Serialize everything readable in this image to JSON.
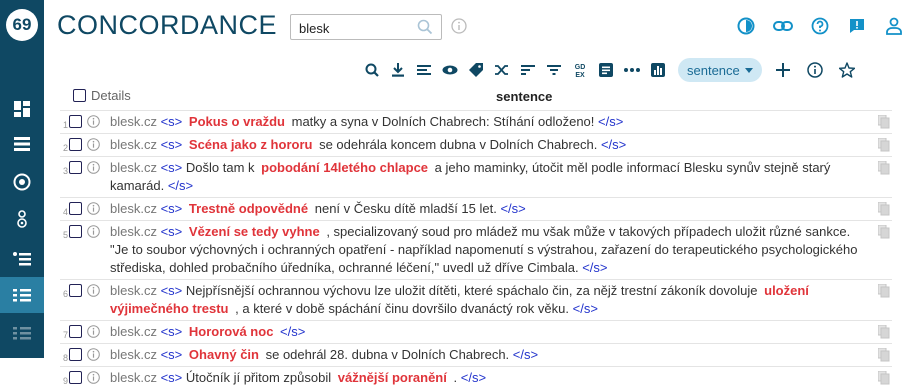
{
  "app": {
    "title": "CONCORDANCE"
  },
  "search": {
    "value": "blesk"
  },
  "toolbar": {
    "view_mode": "sentence"
  },
  "table": {
    "details_label": "Details",
    "column_header": "sentence",
    "rows": [
      {
        "num": "1",
        "source": "blesk.cz",
        "open": "<s>",
        "close": "</s>",
        "left": "",
        "kwic": "Pokus o vraždu",
        "right": "matky a syna v Dolních Chabrech: Stíhání odloženo!"
      },
      {
        "num": "2",
        "source": "blesk.cz",
        "open": "<s>",
        "close": "</s>",
        "left": "",
        "kwic": "Scéna jako z hororu",
        "right": "se odehrála koncem dubna v Dolních Chabrech."
      },
      {
        "num": "3",
        "source": "blesk.cz",
        "open": "<s>",
        "close": "</s>",
        "left": "Došlo tam k",
        "kwic": "pobodání 14letého chlapce",
        "right": "a jeho maminky, útočit měl podle informací Blesku synův stejně starý kamarád."
      },
      {
        "num": "4",
        "source": "blesk.cz",
        "open": "<s>",
        "close": "</s>",
        "left": "",
        "kwic": "Trestně odpovědné",
        "right": "není v Česku dítě mladší 15 let."
      },
      {
        "num": "5",
        "source": "blesk.cz",
        "open": "<s>",
        "close": "</s>",
        "left": "",
        "kwic": "Vězení se tedy vyhne",
        "right": ", specializovaný soud pro mládež mu však může v takových případech uložit různé sankce. \"Je to soubor výchovných i ochranných opatření - například napomenutí s výstrahou, zařazení do terapeutického psychologického střediska, dohled probačního úředníka, ochranné léčení,\" uvedl už dříve Cimbala."
      },
      {
        "num": "6",
        "source": "blesk.cz",
        "open": "<s>",
        "close": "</s>",
        "left": "Nejpřísnější ochrannou výchovu lze uložit dítěti, které spáchalo čin, za nějž trestní zákoník dovoluje",
        "kwic": "uložení výjimečného trestu",
        "right": ", a které v době spáchání činu dovršilo dvanáctý rok věku."
      },
      {
        "num": "7",
        "source": "blesk.cz",
        "open": "<s>",
        "close": "</s>",
        "left": "",
        "kwic": "Hororová noc",
        "right": ""
      },
      {
        "num": "8",
        "source": "blesk.cz",
        "open": "<s>",
        "close": "</s>",
        "left": "",
        "kwic": "Ohavný čin",
        "right": "se odehrál 28. dubna v Dolních Chabrech."
      },
      {
        "num": "9",
        "source": "blesk.cz",
        "open": "<s>",
        "close": "</s>",
        "left": "Útočník jí přitom způsobil",
        "kwic": "vážnější poranění",
        "right": "."
      }
    ]
  }
}
